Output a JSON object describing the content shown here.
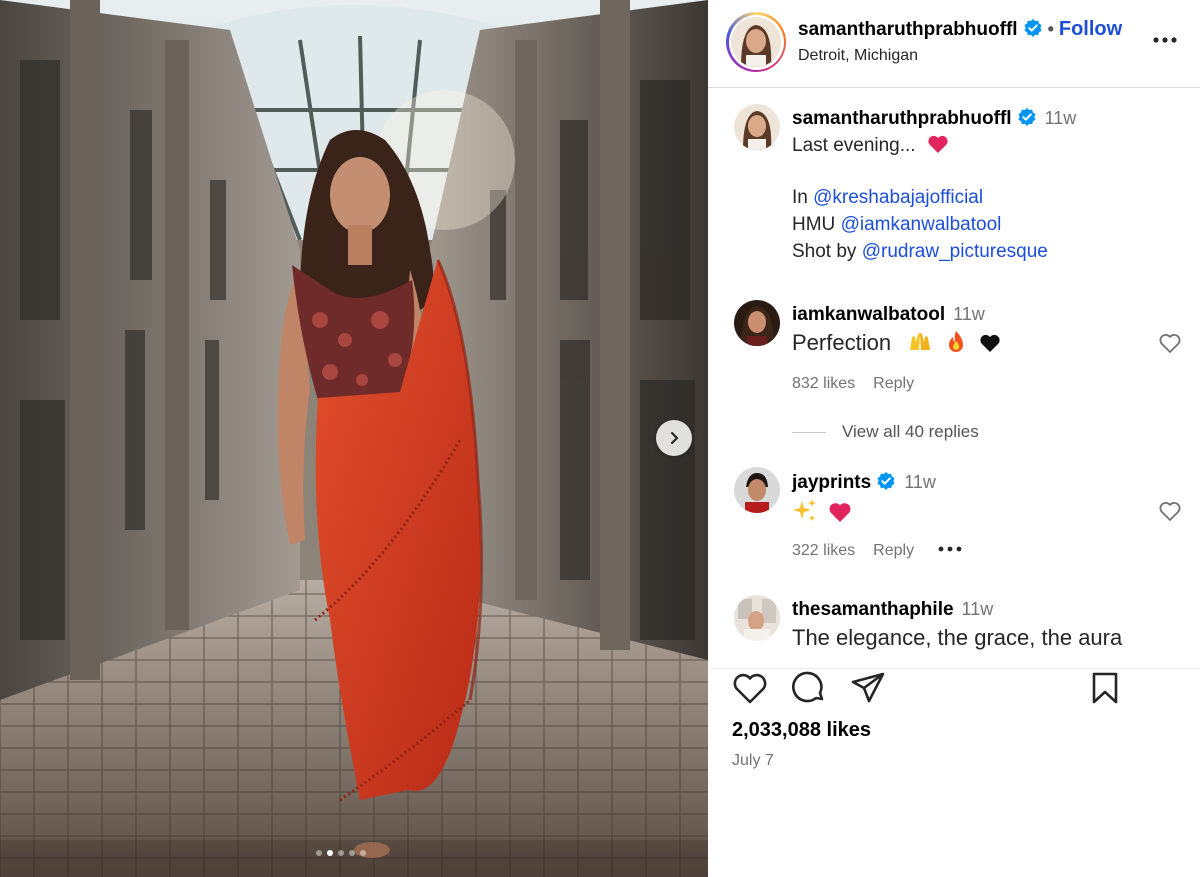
{
  "post": {
    "author": "samantharuthprabhuoffl",
    "location": "Detroit, Michigan",
    "follow_label": "Follow",
    "separator": "•",
    "carousel": {
      "count": 5,
      "active_index": 1
    }
  },
  "caption": {
    "username": "samantharuthprabhuoffl",
    "time": "11w",
    "line1": "Last evening...",
    "line2_prefix": "In ",
    "line2_mention": "@kreshabajajofficial",
    "line3_prefix": "HMU ",
    "line3_mention": "@iamkanwalbatool",
    "line4_prefix": "Shot by ",
    "line4_mention": "@rudraw_picturesque"
  },
  "comments": [
    {
      "username": "iamkanwalbatool",
      "time": "11w",
      "text": "Perfection",
      "likes": "832 likes",
      "reply": "Reply",
      "view_replies": "View all 40 replies"
    },
    {
      "username": "jayprints",
      "time": "11w",
      "text": "",
      "likes": "322 likes",
      "reply": "Reply"
    },
    {
      "username": "thesamanthaphile",
      "time": "11w",
      "text": "The elegance, the grace, the aura"
    }
  ],
  "footer": {
    "likes": "2,033,088 likes",
    "date": "July 7"
  },
  "colors": {
    "link": "#1d4ed8",
    "verified": "#0095f6",
    "muted": "#737373",
    "emoji_heart": "#e0245e"
  },
  "icons": [
    "verified-badge-icon",
    "more-options-icon",
    "chevron-right-icon",
    "heart-outline-icon",
    "comment-icon",
    "share-icon",
    "bookmark-icon",
    "heart-emoji-icon",
    "raised-hands-emoji-icon",
    "fire-emoji-icon",
    "black-heart-emoji-icon",
    "sparkles-emoji-icon"
  ]
}
